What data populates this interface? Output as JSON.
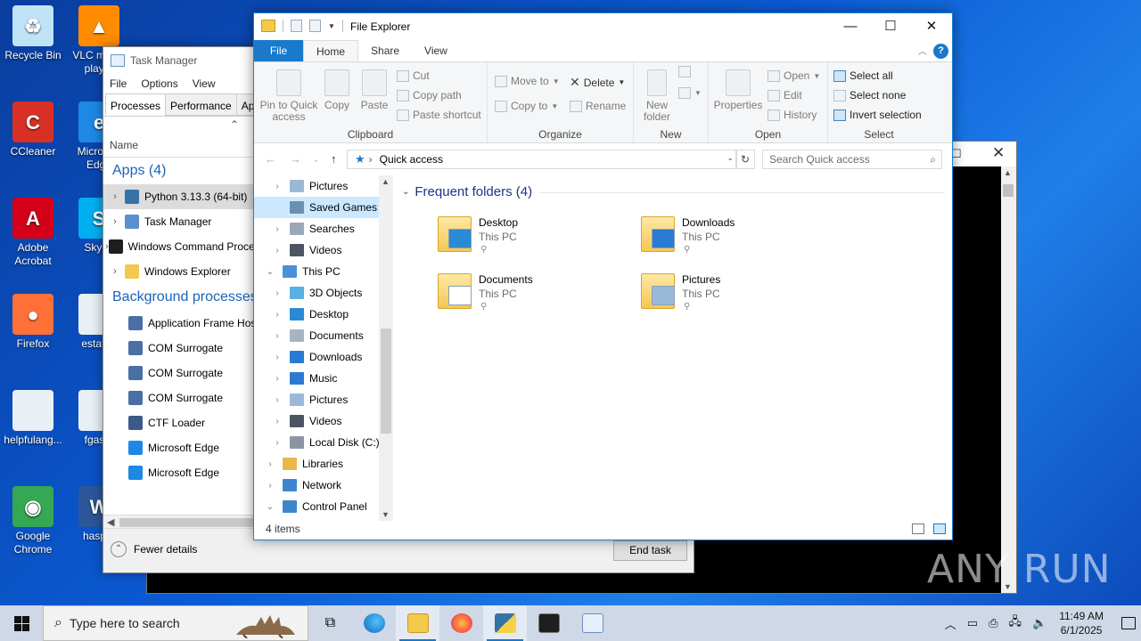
{
  "desktop": {
    "icons": [
      {
        "label": "Recycle Bin",
        "color": "#bfe3f7",
        "glyph": "♻"
      },
      {
        "label": "VLC media player",
        "color": "#ff8c00",
        "glyph": "▲"
      },
      {
        "label": "CCleaner",
        "color": "#d93025",
        "glyph": "C"
      },
      {
        "label": "Microsoft Edge",
        "color": "#1e88e5",
        "glyph": "e"
      },
      {
        "label": "Adobe Acrobat",
        "color": "#d4001a",
        "glyph": "A"
      },
      {
        "label": "Skype",
        "color": "#00aff0",
        "glyph": "S"
      },
      {
        "label": "Firefox",
        "color": "#ff7139",
        "glyph": "●"
      },
      {
        "label": "estatep",
        "color": "#e8f0f6",
        "glyph": ""
      },
      {
        "label": "helpfulang...",
        "color": "#e8f0f6",
        "glyph": ""
      },
      {
        "label": "fgas...",
        "color": "#e8f0f6",
        "glyph": ""
      },
      {
        "label": "Google Chrome",
        "color": "#34a853",
        "glyph": "◉"
      },
      {
        "label": "haspet",
        "color": "#2b579a",
        "glyph": "W"
      }
    ]
  },
  "taskmgr": {
    "title": "Task Manager",
    "menu": [
      "File",
      "Options",
      "View"
    ],
    "tabs": [
      "Processes",
      "Performance",
      "App"
    ],
    "sort_glyph": "⌃",
    "col_name": "Name",
    "apps_header": "Apps (4)",
    "apps": [
      {
        "name": "Python 3.13.3 (64-bit)",
        "color": "#3572a5"
      },
      {
        "name": "Task Manager",
        "color": "#5a8fd0"
      },
      {
        "name": "Windows Command Processor",
        "color": "#1e1e1e"
      },
      {
        "name": "Windows Explorer",
        "color": "#f2c94c"
      }
    ],
    "bg_header": "Background processes",
    "bg": [
      {
        "name": "Application Frame Host",
        "color": "#4a6fa5"
      },
      {
        "name": "COM Surrogate",
        "color": "#4a6fa5"
      },
      {
        "name": "COM Surrogate",
        "color": "#4a6fa5"
      },
      {
        "name": "COM Surrogate",
        "color": "#4a6fa5"
      },
      {
        "name": "CTF Loader",
        "color": "#3b5a8a"
      },
      {
        "name": "Microsoft Edge",
        "color": "#1e88e5"
      },
      {
        "name": "Microsoft Edge",
        "color": "#1e88e5"
      }
    ],
    "fewer_details": "Fewer details",
    "end_task": "End task"
  },
  "explorer": {
    "title": "File Explorer",
    "tabs": {
      "file": "File",
      "home": "Home",
      "share": "Share",
      "view": "View"
    },
    "ribbon": {
      "clipboard": {
        "label": "Clipboard",
        "pin": "Pin to Quick access",
        "copy": "Copy",
        "paste": "Paste",
        "cut": "Cut",
        "copy_path": "Copy path",
        "paste_shortcut": "Paste shortcut"
      },
      "organize": {
        "label": "Organize",
        "move_to": "Move to",
        "copy_to": "Copy to",
        "delete": "Delete",
        "rename": "Rename"
      },
      "new": {
        "label": "New",
        "new_folder": "New folder"
      },
      "open": {
        "label": "Open",
        "properties": "Properties",
        "open": "Open",
        "edit": "Edit",
        "history": "History"
      },
      "select": {
        "label": "Select",
        "select_all": "Select all",
        "select_none": "Select none",
        "invert": "Invert selection"
      }
    },
    "address": "Quick access",
    "search_placeholder": "Search Quick access",
    "nav": [
      {
        "label": "Pictures",
        "indent": 1,
        "caret": "›",
        "color": "#9ab9d6"
      },
      {
        "label": "Saved Games",
        "indent": 1,
        "caret": "",
        "color": "#6a8fb0",
        "selected": true
      },
      {
        "label": "Searches",
        "indent": 1,
        "caret": "›",
        "color": "#9aa9b8"
      },
      {
        "label": "Videos",
        "indent": 1,
        "caret": "›",
        "color": "#4b5563"
      },
      {
        "label": "This PC",
        "indent": 0,
        "caret": "⌄",
        "color": "#4a90d9"
      },
      {
        "label": "3D Objects",
        "indent": 1,
        "caret": "›",
        "color": "#5ab0e0"
      },
      {
        "label": "Desktop",
        "indent": 1,
        "caret": "›",
        "color": "#2a8ad4"
      },
      {
        "label": "Documents",
        "indent": 1,
        "caret": "›",
        "color": "#a7b4c2"
      },
      {
        "label": "Downloads",
        "indent": 1,
        "caret": "›",
        "color": "#2a7ad4"
      },
      {
        "label": "Music",
        "indent": 1,
        "caret": "›",
        "color": "#2a7ad4"
      },
      {
        "label": "Pictures",
        "indent": 1,
        "caret": "›",
        "color": "#9ab9d6"
      },
      {
        "label": "Videos",
        "indent": 1,
        "caret": "›",
        "color": "#4b5563"
      },
      {
        "label": "Local Disk (C:)",
        "indent": 1,
        "caret": "›",
        "color": "#8a96a3"
      },
      {
        "label": "Libraries",
        "indent": 0,
        "caret": "›",
        "color": "#e8b84a"
      },
      {
        "label": "Network",
        "indent": 0,
        "caret": "›",
        "color": "#3d86cc"
      },
      {
        "label": "Control Panel",
        "indent": 0,
        "caret": "⌄",
        "color": "#3d86cc"
      }
    ],
    "frequent_header": "Frequent folders (4)",
    "folders": [
      {
        "name": "Desktop",
        "path": "This PC",
        "overlay": "#2a8ad4"
      },
      {
        "name": "Downloads",
        "path": "This PC",
        "overlay": "#2a7ad4"
      },
      {
        "name": "Documents",
        "path": "This PC",
        "overlay": "#ffffff"
      },
      {
        "name": "Pictures",
        "path": "This PC",
        "overlay": "#9ab9d6"
      }
    ],
    "status_count": "4 items"
  },
  "taskbar": {
    "search_placeholder": "Type here to search",
    "time": "11:49 AM",
    "date": "6/1/2025"
  },
  "watermark": "ANY RUN"
}
